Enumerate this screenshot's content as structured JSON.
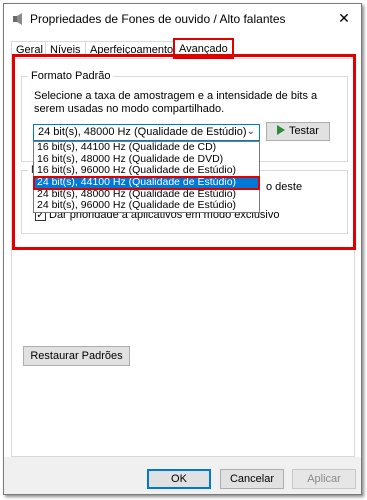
{
  "window": {
    "title": "Propriedades de Fones de ouvido / Alto falantes",
    "close_glyph": "✕"
  },
  "tabs": [
    {
      "label": "Geral"
    },
    {
      "label": "Níveis"
    },
    {
      "label": "Aperfeiçoamentos"
    },
    {
      "label": "Avançado"
    }
  ],
  "active_tab": "Avançado",
  "default_format": {
    "group_label": "Formato Padrão",
    "description": "Selecione a taxa de amostragem e a intensidade de bits a serem usadas no modo compartilhado.",
    "selected_value": "24 bit(s), 48000 Hz (Qualidade de Estúdio)",
    "test_label": "Testar",
    "options": [
      "16 bit(s), 44100 Hz (Qualidade de CD)",
      "16 bit(s), 48000 Hz (Qualidade de DVD)",
      "16 bit(s), 96000 Hz (Qualidade de Estúdio)",
      "24 bit(s), 44100 Hz (Qualidade de Estúdio)",
      "24 bit(s), 48000 Hz (Qualidade de Estúdio)",
      "24 bit(s), 96000 Hz (Qualidade de Estúdio)"
    ],
    "highlighted_option": "24 bit(s), 44100 Hz (Qualidade de Estúdio)"
  },
  "exclusive_mode": {
    "group_label": "M",
    "allow_control_label_tail": "o deste",
    "priority_label": "Dar prioridade a aplicativos em modo exclusivo",
    "allow_checked": true,
    "priority_checked": true
  },
  "restore_defaults_label": "Restaurar Padrões",
  "footer": {
    "ok_label": "OK",
    "cancel_label": "Cancelar",
    "apply_label": "Aplicar"
  },
  "colors": {
    "highlight_red": "#e00000",
    "selection_blue": "#0078d7",
    "test_icon_green": "#2d8a3a"
  }
}
